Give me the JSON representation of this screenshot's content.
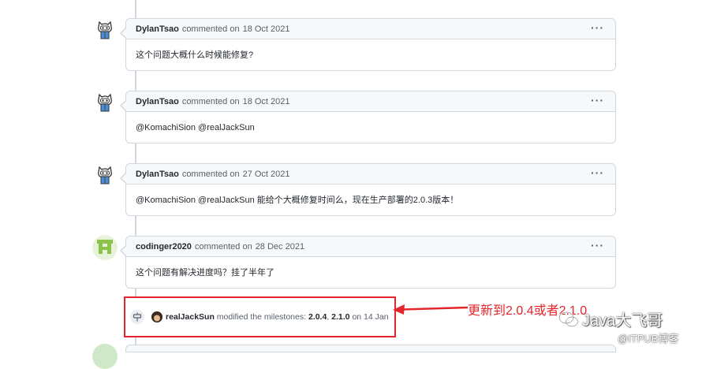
{
  "comments": [
    {
      "author": "DylanTsao",
      "verb": "commented on",
      "date": "18 Oct 2021",
      "body": "这个问题大概什么时候能修复?"
    },
    {
      "author": "DylanTsao",
      "verb": "commented on",
      "date": "18 Oct 2021",
      "body": "@KomachiSion @realJackSun"
    },
    {
      "author": "DylanTsao",
      "verb": "commented on",
      "date": "27 Oct 2021",
      "body": "@KomachiSion @realJackSun 能给个大概修复时间么，现在生产部署的2.0.3版本！"
    },
    {
      "author": "codinger2020",
      "verb": "commented on",
      "date": "28 Dec 2021",
      "body": "这个问题有解决进度吗？挂了半年了"
    }
  ],
  "more_label": "···",
  "event": {
    "actor": "realJackSun",
    "action": "modified the milestones:",
    "m1": "2.0.4",
    "sep": ",",
    "m2": "2.1.0",
    "when": "on 14 Jan"
  },
  "annotation": "更新到2.0.4或者2.1.0",
  "watermark": {
    "line1": "Java大飞哥",
    "line2": "@ITPUB博客"
  },
  "colors": {
    "annotation_red": "#e3262b",
    "border": "#d0d7de",
    "header_bg": "#f6f8fa",
    "identicon_green": "#8bc34a"
  }
}
